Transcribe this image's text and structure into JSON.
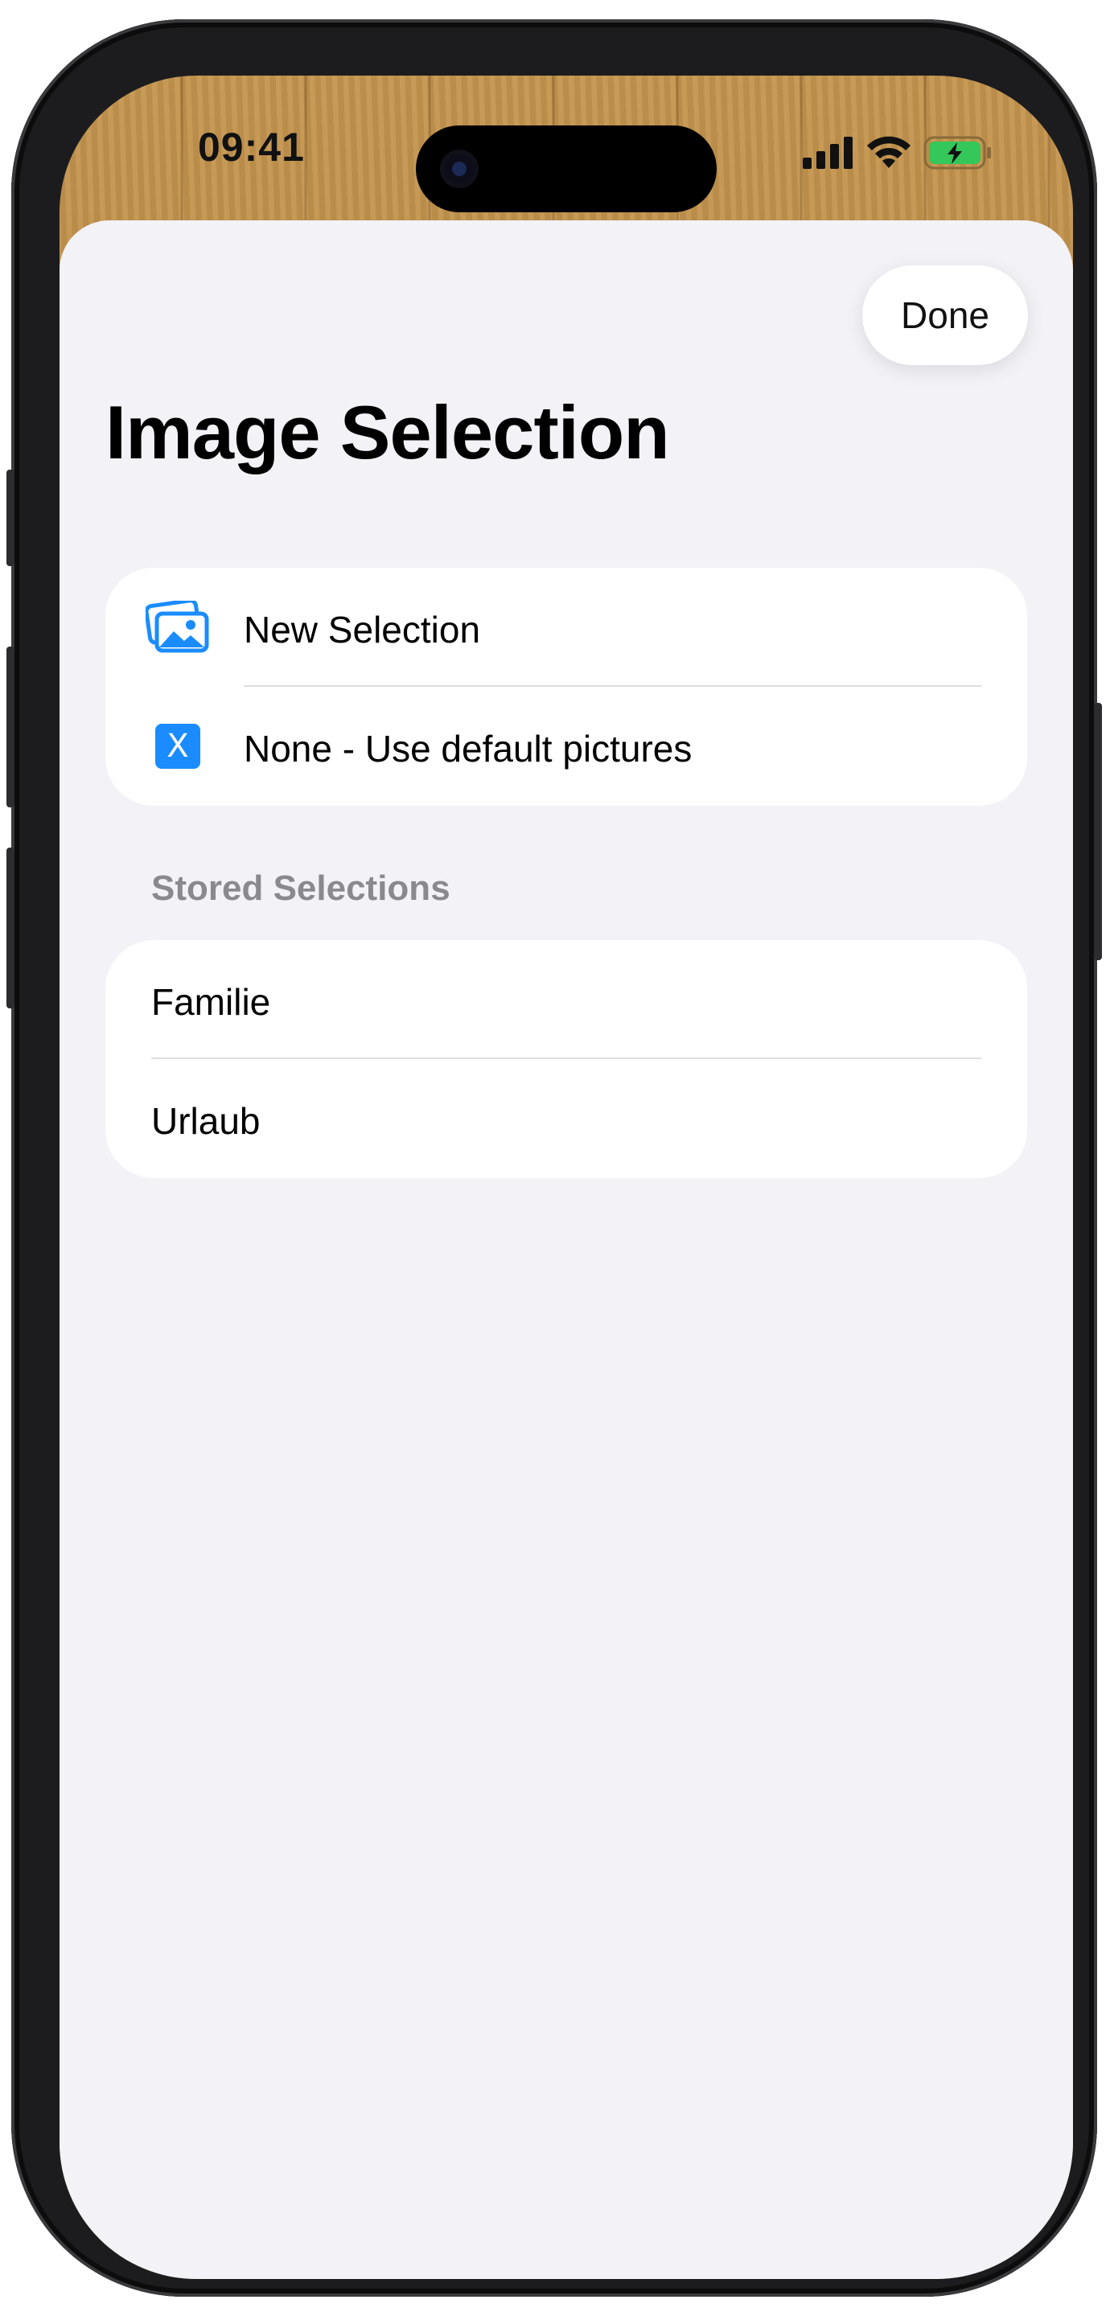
{
  "status_bar": {
    "time": "09:41",
    "icons": [
      "cellular-signal-icon",
      "wifi-icon",
      "battery-charging-icon"
    ]
  },
  "toolbar": {
    "done_label": "Done"
  },
  "page": {
    "title": "Image Selection"
  },
  "actions": [
    {
      "label": "New Selection",
      "icon": "photos-icon"
    },
    {
      "label": "None - Use default pictures",
      "icon": "x-box-icon",
      "icon_glyph": "X"
    }
  ],
  "stored": {
    "header": "Stored Selections",
    "items": [
      {
        "label": "Familie"
      },
      {
        "label": "Urlaub"
      }
    ]
  },
  "colors": {
    "accent": "#1a8cff",
    "background": "#f2f2f7",
    "battery": "#34c759"
  }
}
